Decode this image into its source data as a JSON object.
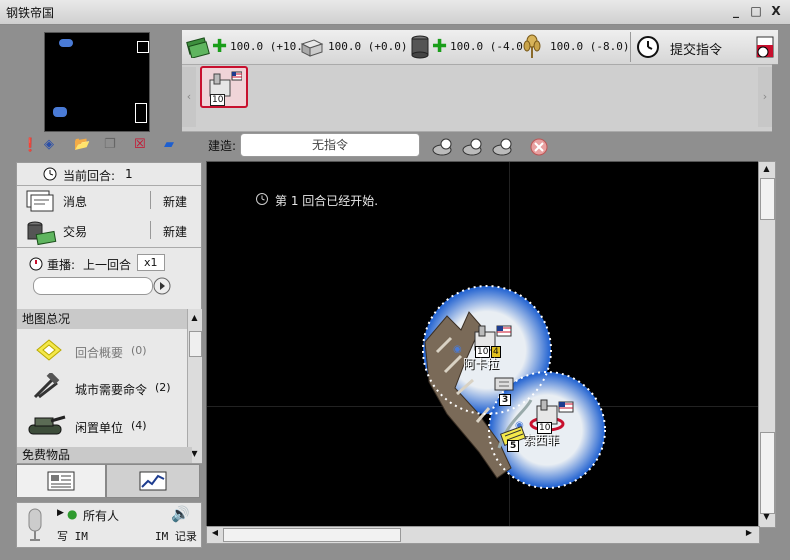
{
  "window": {
    "title": "钢铁帝国",
    "minimize": "_",
    "maximize": "□",
    "close": "X"
  },
  "resources": [
    {
      "name": "money",
      "icon": "money-icon",
      "value": "100.0 (+10."
    },
    {
      "name": "steel",
      "icon": "steel-icon",
      "value": "100.0 (+0.0)"
    },
    {
      "name": "oil",
      "icon": "oil-barrel-icon",
      "value": "100.0 (-4.0"
    },
    {
      "name": "food",
      "icon": "wheat-icon",
      "value": "100.0 (-8.0)"
    }
  ],
  "submit_label": "提交指令",
  "unit_bar": {
    "slot_count": "10"
  },
  "build": {
    "label": "建造:",
    "command_value": "无指令"
  },
  "turn": {
    "label": "当前回合:",
    "number": "1"
  },
  "messages": {
    "label": "消息",
    "new": "新建"
  },
  "trade": {
    "label": "交易",
    "new": "新建"
  },
  "replay": {
    "label": "重播:",
    "mode": "上一回合",
    "speed": "x1"
  },
  "overview": {
    "header": "地图总况",
    "items": [
      {
        "label": "回合概要",
        "count": "(0)"
      },
      {
        "label": "城市需要命令",
        "count": "(2)"
      },
      {
        "label": "闲置单位",
        "count": "(4)"
      }
    ],
    "next_header": "免费物品"
  },
  "map": {
    "turn_message": "第 1 回合已经开始.",
    "cities": [
      {
        "name": "阿卡拉",
        "size": "10",
        "extra": "4"
      },
      {
        "name": "索西菲",
        "size": "10"
      }
    ],
    "units": [
      {
        "count": "3"
      },
      {
        "count": "5"
      }
    ]
  },
  "chat": {
    "recipient": "所有人",
    "write_label": "写 IM",
    "log_label": "IM 记录"
  },
  "colors": {
    "accent": "#c8102e",
    "ocean": "#1d5fd0",
    "map_bg": "#000000"
  }
}
